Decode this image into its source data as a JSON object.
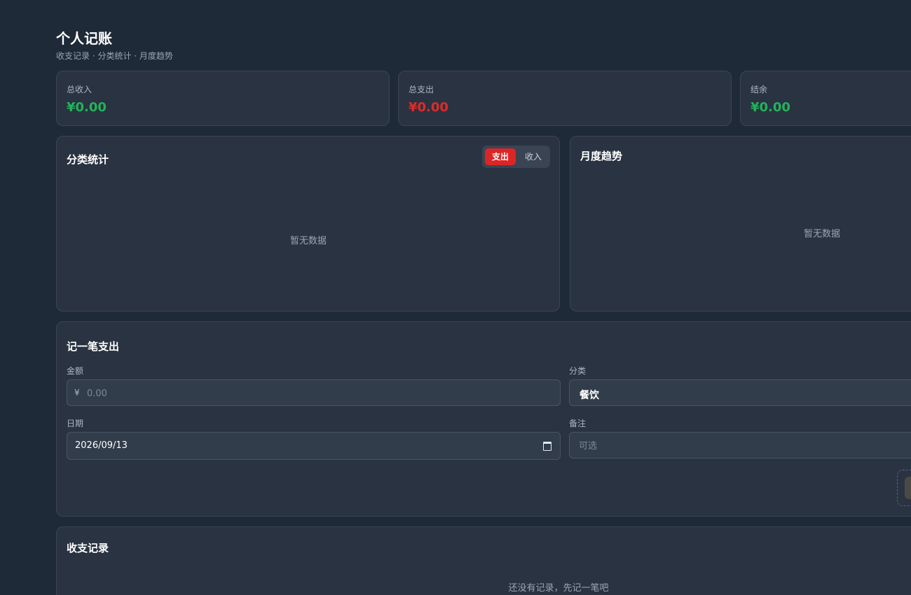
{
  "header": {
    "title": "个人记账",
    "subtitle": "收支记录 · 分类统计 · 月度趋势"
  },
  "summary": {
    "income": {
      "label": "总收入",
      "value": "¥0.00"
    },
    "expense": {
      "label": "总支出",
      "value": "¥0.00"
    },
    "balance": {
      "label": "结余",
      "value": "¥0.00"
    }
  },
  "category_stats": {
    "title": "分类统计",
    "toggle": {
      "expense_label": "支出",
      "income_label": "收入",
      "selected": "支出"
    },
    "empty_text": "暂无数据"
  },
  "monthly_trend": {
    "title": "月度趋势",
    "empty_text": "暂无数据"
  },
  "entry_form": {
    "title": "记一笔支出",
    "amount": {
      "label": "金额",
      "currency": "¥",
      "placeholder": "0.00"
    },
    "category": {
      "label": "分类",
      "value": "餐饮"
    },
    "date": {
      "label": "日期",
      "value": "2026/09/13"
    },
    "note": {
      "label": "备注",
      "placeholder": "可选"
    }
  },
  "records": {
    "title": "收支记录",
    "empty_text": "还没有记录，先记一笔吧"
  },
  "colors": {
    "background": "#1f2a38",
    "card": "#293341",
    "income_green": "#22b35a",
    "expense_red": "#e02a2a",
    "toggle_active": "#dc2626"
  }
}
